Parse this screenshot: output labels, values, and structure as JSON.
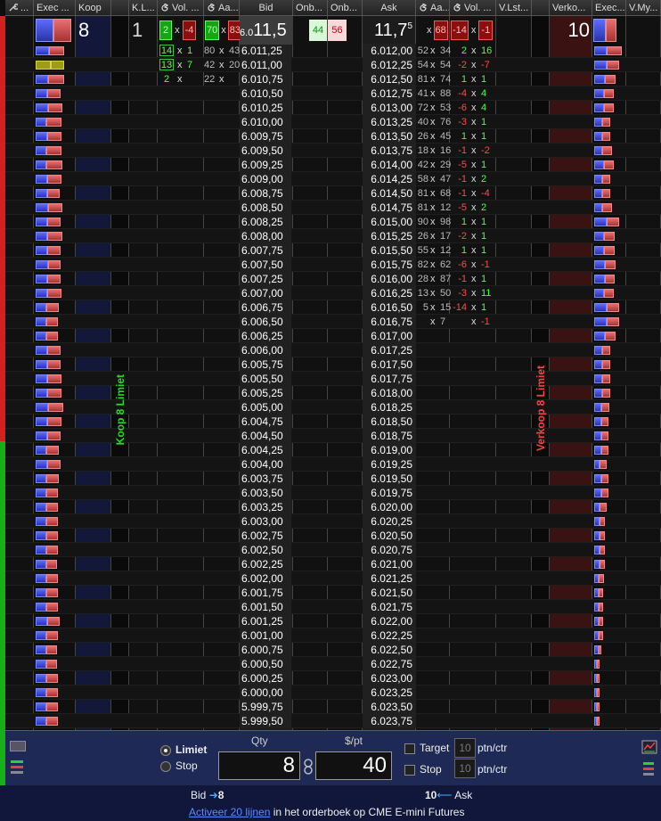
{
  "columns": {
    "exec_buy": "Exec ...",
    "buy": "Koop",
    "kl": "K.L...",
    "vol_left": "Vol. ...",
    "aa_left": "Aa...",
    "bid": "Bid",
    "onb_left": "Onb...",
    "onb_right": "Onb...",
    "ask": "Ask",
    "aa_right": "Aa...",
    "vol_right": "Vol. ...",
    "vlst": "V.Lst...",
    "sell": "Verko...",
    "exec_sell": "Exec...",
    "vmy": "V.My..."
  },
  "summary": {
    "buy_qty": "8",
    "kl": "1",
    "vol_left_a": "2",
    "vol_left_b": "-4",
    "aa_left_a": "70",
    "aa_left_b": "83",
    "bid_prefix": "6.0",
    "bid_big": "11,5",
    "onb_left": "44",
    "onb_right": "56",
    "ask_big": "11,7",
    "ask_sup": "5",
    "aa_right_b": "68",
    "vol_right_a": "-14",
    "vol_right_b": "-1",
    "sell_qty": "10",
    "x": "x"
  },
  "ladder": {
    "bid_prices": [
      "6.011,25",
      "6.011,00",
      "6.010,75",
      "6.010,50",
      "6.010,25",
      "6.010,00",
      "6.009,75",
      "6.009,50",
      "6.009,25",
      "6.009,00",
      "6.008,75",
      "6.008,50",
      "6.008,25",
      "6.008,00",
      "6.007,75",
      "6.007,50",
      "6.007,25",
      "6.007,00",
      "6.006,75",
      "6.006,50",
      "6.006,25",
      "6.006,00",
      "6.005,75",
      "6.005,50",
      "6.005,25",
      "6.005,00",
      "6.004,75",
      "6.004,50",
      "6.004,25",
      "6.004,00",
      "6.003,75",
      "6.003,50",
      "6.003,25",
      "6.003,00",
      "6.002,75",
      "6.002,50",
      "6.002,25",
      "6.002,00",
      "6.001,75",
      "6.001,50",
      "6.001,25",
      "6.001,00",
      "6.000,75",
      "6.000,50",
      "6.000,25",
      "6.000,00",
      "5.999,75",
      "5.999,50"
    ],
    "ask_prices": [
      "6.012,00",
      "6.012,25",
      "6.012,50",
      "6.012,75",
      "6.013,00",
      "6.013,25",
      "6.013,50",
      "6.013,75",
      "6.014,00",
      "6.014,25",
      "6.014,50",
      "6.014,75",
      "6.015,00",
      "6.015,25",
      "6.015,50",
      "6.015,75",
      "6.016,00",
      "6.016,25",
      "6.016,50",
      "6.016,75",
      "6.017,00",
      "6.017,25",
      "6.017,50",
      "6.017,75",
      "6.018,00",
      "6.018,25",
      "6.018,50",
      "6.018,75",
      "6.019,00",
      "6.019,25",
      "6.019,50",
      "6.019,75",
      "6.020,00",
      "6.020,25",
      "6.020,50",
      "6.020,75",
      "6.021,00",
      "6.021,25",
      "6.021,50",
      "6.021,75",
      "6.022,00",
      "6.022,25",
      "6.022,50",
      "6.022,75",
      "6.023,00",
      "6.023,25",
      "6.023,50",
      "6.023,75"
    ],
    "vol_left": [
      {
        "a": "14",
        "b": "1",
        "boxed": true
      },
      {
        "a": "13",
        "b": "7",
        "boxed": true
      },
      {
        "a": "2",
        "b": "",
        "boxed": false
      }
    ],
    "aa_left": [
      {
        "a": "80",
        "b": "43"
      },
      {
        "a": "42",
        "b": "20"
      },
      {
        "a": "22",
        "b": ""
      }
    ],
    "aa_right": [
      {
        "a": "52",
        "b": "34"
      },
      {
        "a": "54",
        "b": "54"
      },
      {
        "a": "81",
        "b": "74"
      },
      {
        "a": "41",
        "b": "88"
      },
      {
        "a": "72",
        "b": "53"
      },
      {
        "a": "40",
        "b": "76"
      },
      {
        "a": "26",
        "b": "45"
      },
      {
        "a": "18",
        "b": "16"
      },
      {
        "a": "42",
        "b": "29"
      },
      {
        "a": "58",
        "b": "47"
      },
      {
        "a": "81",
        "b": "68"
      },
      {
        "a": "81",
        "b": "12"
      },
      {
        "a": "90",
        "b": "98"
      },
      {
        "a": "26",
        "b": "17"
      },
      {
        "a": "55",
        "b": "12"
      },
      {
        "a": "82",
        "b": "62"
      },
      {
        "a": "28",
        "b": "87"
      },
      {
        "a": "13",
        "b": "50"
      },
      {
        "a": "5",
        "b": "15"
      },
      {
        "a": "",
        "b": "7"
      }
    ],
    "vol_right": [
      {
        "a": "2",
        "b": "16"
      },
      {
        "a": "-2",
        "b": "-7"
      },
      {
        "a": "1",
        "b": "1"
      },
      {
        "a": "-4",
        "b": "4"
      },
      {
        "a": "-6",
        "b": "4"
      },
      {
        "a": "-3",
        "b": "1"
      },
      {
        "a": "1",
        "b": "1"
      },
      {
        "a": "-1",
        "b": "-2"
      },
      {
        "a": "-5",
        "b": "1"
      },
      {
        "a": "-1",
        "b": "2"
      },
      {
        "a": "-1",
        "b": "-4"
      },
      {
        "a": "-5",
        "b": "2"
      },
      {
        "a": "1",
        "b": "1"
      },
      {
        "a": "-2",
        "b": "1"
      },
      {
        "a": "1",
        "b": "1"
      },
      {
        "a": "-6",
        "b": "-1"
      },
      {
        "a": "-1",
        "b": "1"
      },
      {
        "a": "-3",
        "b": "11"
      },
      {
        "a": "-14",
        "b": "1"
      },
      {
        "a": "",
        "b": "-1"
      }
    ],
    "buy_side_label": "Koop 8 Limiet",
    "sell_side_label": "Verkoop 8 Limiet"
  },
  "exec_buy_bars": [
    [
      0.45,
      0.55
    ],
    [
      0.55,
      0.45
    ],
    [
      0.4,
      0.6
    ],
    [
      0.35,
      0.45
    ],
    [
      0.4,
      0.5
    ],
    [
      0.3,
      0.55
    ],
    [
      0.35,
      0.5
    ],
    [
      0.3,
      0.55
    ],
    [
      0.3,
      0.6
    ],
    [
      0.35,
      0.5
    ],
    [
      0.35,
      0.4
    ],
    [
      0.4,
      0.5
    ],
    [
      0.35,
      0.45
    ],
    [
      0.35,
      0.55
    ],
    [
      0.35,
      0.45
    ],
    [
      0.4,
      0.4
    ],
    [
      0.35,
      0.45
    ],
    [
      0.35,
      0.5
    ],
    [
      0.3,
      0.4
    ],
    [
      0.3,
      0.35
    ],
    [
      0.3,
      0.35
    ],
    [
      0.35,
      0.45
    ],
    [
      0.35,
      0.45
    ],
    [
      0.35,
      0.5
    ],
    [
      0.35,
      0.5
    ],
    [
      0.4,
      0.55
    ],
    [
      0.35,
      0.5
    ],
    [
      0.35,
      0.45
    ],
    [
      0.3,
      0.4
    ],
    [
      0.35,
      0.45
    ],
    [
      0.3,
      0.4
    ],
    [
      0.3,
      0.35
    ],
    [
      0.3,
      0.35
    ],
    [
      0.3,
      0.35
    ],
    [
      0.3,
      0.35
    ],
    [
      0.3,
      0.35
    ],
    [
      0.3,
      0.3
    ],
    [
      0.3,
      0.35
    ],
    [
      0.3,
      0.35
    ],
    [
      0.3,
      0.35
    ],
    [
      0.35,
      0.4
    ],
    [
      0.3,
      0.35
    ],
    [
      0.3,
      0.3
    ],
    [
      0.3,
      0.3
    ],
    [
      0.3,
      0.35
    ],
    [
      0.3,
      0.35
    ],
    [
      0.3,
      0.35
    ],
    [
      0.3,
      0.35
    ]
  ],
  "exec_sell_bars": [
    [
      0.45,
      0.55
    ],
    [
      0.45,
      0.45
    ],
    [
      0.4,
      0.4
    ],
    [
      0.35,
      0.35
    ],
    [
      0.35,
      0.35
    ],
    [
      0.3,
      0.3
    ],
    [
      0.3,
      0.3
    ],
    [
      0.3,
      0.35
    ],
    [
      0.35,
      0.35
    ],
    [
      0.3,
      0.3
    ],
    [
      0.3,
      0.3
    ],
    [
      0.3,
      0.35
    ],
    [
      0.45,
      0.45
    ],
    [
      0.35,
      0.4
    ],
    [
      0.35,
      0.4
    ],
    [
      0.4,
      0.4
    ],
    [
      0.4,
      0.35
    ],
    [
      0.35,
      0.35
    ],
    [
      0.45,
      0.45
    ],
    [
      0.45,
      0.45
    ],
    [
      0.4,
      0.4
    ],
    [
      0.3,
      0.3
    ],
    [
      0.3,
      0.3
    ],
    [
      0.3,
      0.3
    ],
    [
      0.3,
      0.3
    ],
    [
      0.25,
      0.3
    ],
    [
      0.25,
      0.25
    ],
    [
      0.25,
      0.25
    ],
    [
      0.25,
      0.25
    ],
    [
      0.2,
      0.25
    ],
    [
      0.25,
      0.25
    ],
    [
      0.25,
      0.25
    ],
    [
      0.2,
      0.25
    ],
    [
      0.2,
      0.2
    ],
    [
      0.2,
      0.2
    ],
    [
      0.2,
      0.2
    ],
    [
      0.2,
      0.2
    ],
    [
      0.15,
      0.2
    ],
    [
      0.15,
      0.15
    ],
    [
      0.15,
      0.15
    ],
    [
      0.15,
      0.15
    ],
    [
      0.15,
      0.15
    ],
    [
      0.15,
      0.1
    ],
    [
      0.1,
      0.1
    ],
    [
      0.1,
      0.1
    ],
    [
      0.1,
      0.1
    ],
    [
      0.1,
      0.1
    ],
    [
      0.1,
      0.1
    ]
  ],
  "bottom": {
    "limit_label": "Limiet",
    "stop_label": "Stop",
    "qty_label": "Qty",
    "price_label": "$/pt",
    "qty_value": "8",
    "price_value": "40",
    "target_label": "Target",
    "target_value": "10",
    "target_unit": "ptn/ctr",
    "stop2_label": "Stop",
    "stop2_value": "10",
    "stop2_unit": "ptn/ctr"
  },
  "footer": {
    "bid_label": "Bid",
    "bid_value": "8",
    "ask_value": "10",
    "ask_label": "Ask",
    "link": "Activeer 20 lijnen",
    "rest": " in het orderboek op CME E-mini Futures"
  },
  "colors": {
    "buy": "#1a1a3a",
    "sell": "#3a1010",
    "green": "#00cc00",
    "red": "#ff4444"
  }
}
